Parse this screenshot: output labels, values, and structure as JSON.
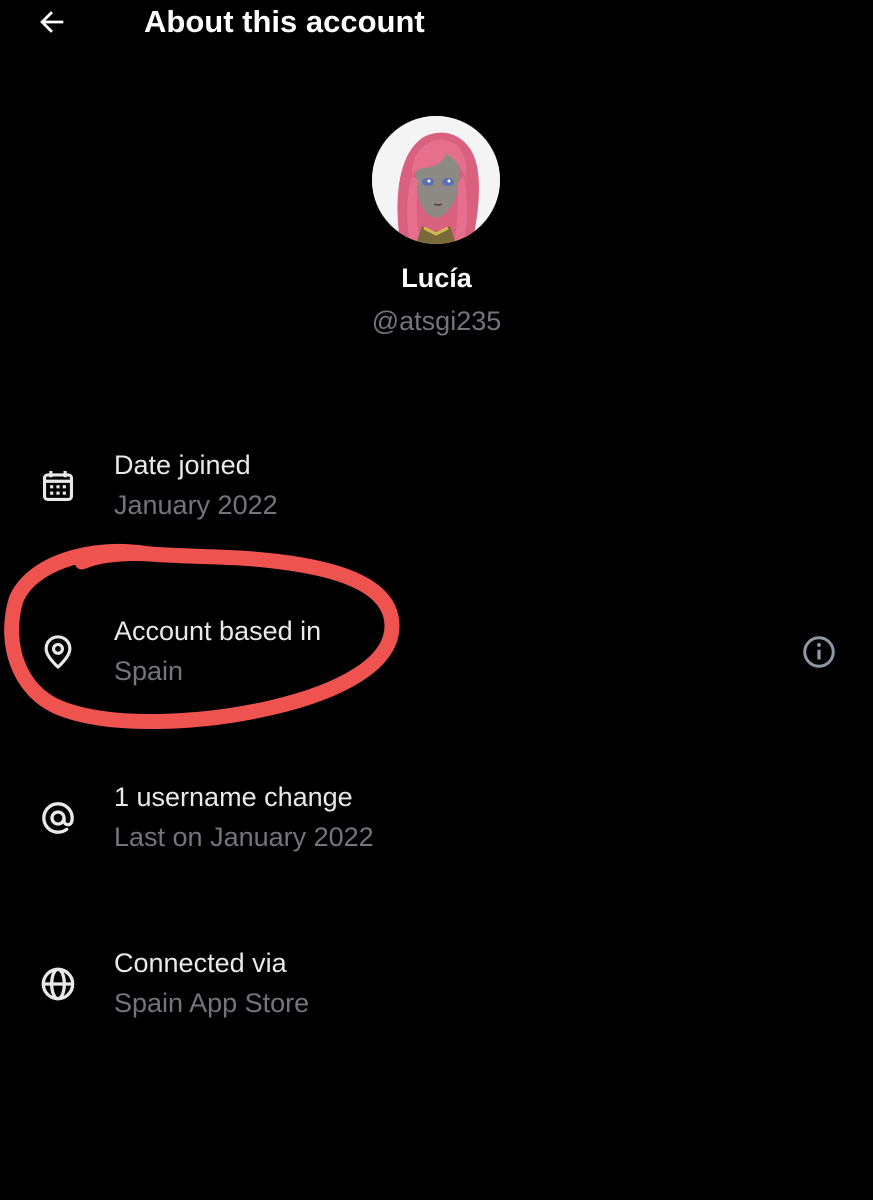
{
  "header": {
    "back_icon": "arrow-left-icon",
    "title": "About this account"
  },
  "profile": {
    "display_name": "Lucía",
    "handle": "@atsgi235",
    "avatar": "anime-girl-pink-hair-avatar"
  },
  "details": [
    {
      "icon": "calendar-icon",
      "label": "Date joined",
      "value": "January 2022"
    },
    {
      "icon": "location-pin-icon",
      "label": "Account based in",
      "value": "Spain",
      "action_icon": "info-icon"
    },
    {
      "icon": "at-sign-icon",
      "label": "1 username change",
      "value": "Last on January 2022"
    },
    {
      "icon": "globe-icon",
      "label": "Connected via",
      "value": "Spain App Store"
    }
  ],
  "annotation": {
    "type": "hand-drawn circle",
    "color": "#ef5350"
  },
  "colors": {
    "background": "#000000",
    "primary_text": "#e7e9ea",
    "secondary_text": "#71767b"
  }
}
